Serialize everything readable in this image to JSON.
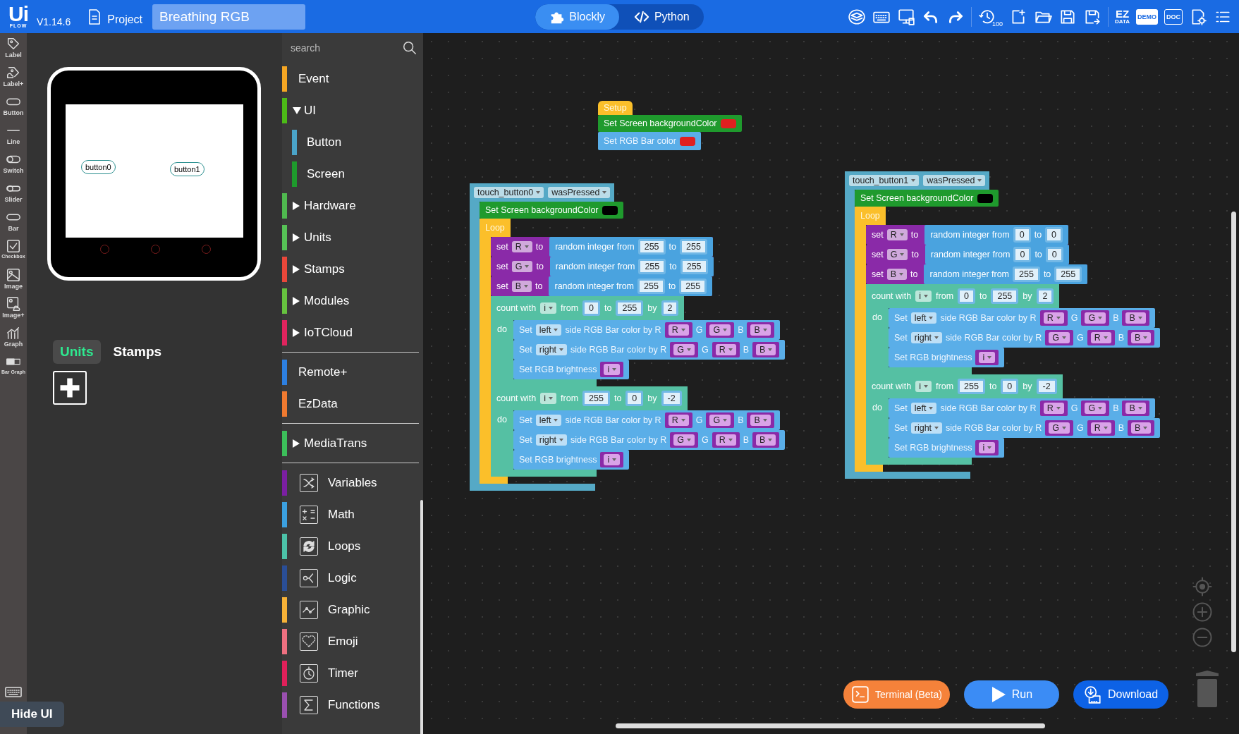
{
  "header": {
    "logo": {
      "mark": "Ui",
      "sub": "FLOW"
    },
    "version": "V1.14.6",
    "project_label": "Project",
    "project_name": "Breathing RGB",
    "modes": [
      {
        "label": "Blockly",
        "selected": true
      },
      {
        "label": "Python",
        "selected": false
      }
    ],
    "toolbar": [
      {
        "kind": "layers"
      },
      {
        "kind": "keyboard"
      },
      {
        "kind": "monitor"
      },
      {
        "kind": "undo"
      },
      {
        "kind": "redo"
      },
      {
        "kind": "history",
        "label": "100"
      },
      {
        "kind": "new"
      },
      {
        "kind": "open"
      },
      {
        "kind": "save"
      },
      {
        "kind": "save-as"
      },
      {
        "kind": "ezdata",
        "label": "EZ",
        "sublabel": "DATA"
      },
      {
        "kind": "demo",
        "label": "DEMO"
      },
      {
        "kind": "doc",
        "label": "DOC"
      },
      {
        "kind": "file-settings"
      },
      {
        "kind": "menu"
      }
    ]
  },
  "rail": {
    "items": [
      {
        "label": "Label"
      },
      {
        "label": "Label+"
      },
      {
        "label": "Button"
      },
      {
        "label": "Line"
      },
      {
        "label": "Switch"
      },
      {
        "label": "Slider"
      },
      {
        "label": "Bar"
      },
      {
        "label": "Checkbox"
      },
      {
        "label": "Image"
      },
      {
        "label": "Image+"
      },
      {
        "label": "Graph"
      },
      {
        "label": "Bar Graph"
      }
    ],
    "hide_button": "Hide UI"
  },
  "device": {
    "buttons": [
      {
        "label": "button0"
      },
      {
        "label": "button1"
      }
    ]
  },
  "panel_tabs": [
    {
      "label": "Units",
      "selected": true
    },
    {
      "label": "Stamps",
      "selected": false
    }
  ],
  "palette": {
    "search": {
      "placeholder": "search"
    },
    "groups": [
      {
        "items": [
          {
            "kind": "leaf",
            "label": "Event",
            "color": "#f5a623"
          },
          {
            "kind": "folder",
            "label": "UI",
            "color": "#4cbb17",
            "expanded": true,
            "children": [
              {
                "label": "Button",
                "color": "#4aa3c8"
              },
              {
                "label": "Screen",
                "color": "#1e9a2c"
              }
            ]
          },
          {
            "kind": "folder",
            "label": "Hardware",
            "color": "#4fb94f",
            "expanded": false
          },
          {
            "kind": "folder",
            "label": "Units",
            "color": "#56c256",
            "expanded": false
          },
          {
            "kind": "folder",
            "label": "Stamps",
            "color": "#e9473a",
            "expanded": false
          },
          {
            "kind": "folder",
            "label": "Modules",
            "color": "#66c23f",
            "expanded": false
          },
          {
            "kind": "folder",
            "label": "IoTCloud",
            "color": "#e0245e",
            "expanded": false
          }
        ]
      },
      {
        "items": [
          {
            "kind": "leaf",
            "label": "Remote+",
            "color": "#2d7fe0"
          },
          {
            "kind": "leaf",
            "label": "EzData",
            "color": "#f07a30"
          }
        ]
      },
      {
        "items": [
          {
            "kind": "folder",
            "label": "MediaTrans",
            "color": "#3cbf5a",
            "expanded": false
          }
        ]
      },
      {
        "items": [
          {
            "kind": "tool",
            "label": "Variables",
            "color": "#7b1fa2"
          },
          {
            "kind": "tool",
            "label": "Math",
            "color": "#3ba0e0"
          },
          {
            "kind": "tool",
            "label": "Loops",
            "color": "#4cc2a8"
          },
          {
            "kind": "tool",
            "label": "Logic",
            "color": "#2a4e96"
          },
          {
            "kind": "tool",
            "label": "Graphic",
            "color": "#f7b237"
          },
          {
            "kind": "tool",
            "label": "Emoji",
            "color": "#ee7080"
          },
          {
            "kind": "tool",
            "label": "Timer",
            "color": "#e0205a"
          },
          {
            "kind": "tool",
            "label": "Functions",
            "color": "#9a50b0"
          }
        ]
      }
    ]
  },
  "workspace": {
    "stacks": [
      {
        "kind": "setup",
        "label": "Setup",
        "body": [
          {
            "kind": "screen",
            "parts": [
              {
                "label": "Set Screen backgroundColor"
              },
              {
                "color": "#e02020"
              }
            ]
          },
          {
            "kind": "rgb",
            "parts": [
              {
                "label": "Set RGB Bar color"
              },
              {
                "color": "#e02020"
              }
            ]
          }
        ]
      },
      {
        "kind": "event",
        "parts": [
          {
            "dropdown": "touch_button0"
          },
          {
            "dropdown": "wasPressed"
          }
        ],
        "body": [
          {
            "kind": "screen",
            "parts": [
              {
                "label": "Set Screen backgroundColor"
              },
              {
                "color": "#000000"
              }
            ]
          },
          {
            "kind": "loop",
            "label": "Loop",
            "body": [
              {
                "kind": "variables",
                "parts": [
                  {
                    "label": "set"
                  },
                  {
                    "dropdown": "R"
                  },
                  {
                    "label": "to"
                  },
                  {
                    "value": {
                      "kind": "math",
                      "parts": [
                        {
                          "label": "random integer from"
                        },
                        {
                          "number": "255"
                        },
                        {
                          "label": "to"
                        },
                        {
                          "number": "255"
                        }
                      ]
                    }
                  }
                ]
              },
              {
                "kind": "variables",
                "parts": [
                  {
                    "label": "set"
                  },
                  {
                    "dropdown": "G"
                  },
                  {
                    "label": "to"
                  },
                  {
                    "value": {
                      "kind": "math",
                      "parts": [
                        {
                          "label": "random integer from"
                        },
                        {
                          "number": "255"
                        },
                        {
                          "label": "to"
                        },
                        {
                          "number": "255"
                        }
                      ]
                    }
                  }
                ]
              },
              {
                "kind": "variables",
                "parts": [
                  {
                    "label": "set"
                  },
                  {
                    "dropdown": "B"
                  },
                  {
                    "label": "to"
                  },
                  {
                    "value": {
                      "kind": "math",
                      "parts": [
                        {
                          "label": "random integer from"
                        },
                        {
                          "number": "255"
                        },
                        {
                          "label": "to"
                        },
                        {
                          "number": "255"
                        }
                      ]
                    }
                  }
                ]
              },
              {
                "kind": "count",
                "parts": [
                  {
                    "label": "count with"
                  },
                  {
                    "dropdown": "i"
                  },
                  {
                    "label": "from"
                  },
                  {
                    "number": "0"
                  },
                  {
                    "label": "to"
                  },
                  {
                    "number": "255"
                  },
                  {
                    "label": "by"
                  },
                  {
                    "number": "2"
                  }
                ],
                "do": "do",
                "body": [
                  {
                    "kind": "rgb",
                    "parts": [
                      {
                        "label": "Set"
                      },
                      {
                        "dropdown": "left"
                      },
                      {
                        "label": "side RGB Bar color by R"
                      },
                      {
                        "var": "R"
                      },
                      {
                        "label": "G"
                      },
                      {
                        "var": "G"
                      },
                      {
                        "label": "B"
                      },
                      {
                        "var": "B"
                      }
                    ]
                  },
                  {
                    "kind": "rgb",
                    "parts": [
                      {
                        "label": "Set"
                      },
                      {
                        "dropdown": "right"
                      },
                      {
                        "label": "side RGB Bar color by R"
                      },
                      {
                        "var": "G"
                      },
                      {
                        "label": "G"
                      },
                      {
                        "var": "R"
                      },
                      {
                        "label": "B"
                      },
                      {
                        "var": "B"
                      }
                    ]
                  },
                  {
                    "kind": "rgb",
                    "parts": [
                      {
                        "label": "Set RGB brightness"
                      },
                      {
                        "var": "i"
                      }
                    ]
                  }
                ]
              },
              {
                "kind": "count",
                "parts": [
                  {
                    "label": "count with"
                  },
                  {
                    "dropdown": "i"
                  },
                  {
                    "label": "from"
                  },
                  {
                    "number": "255"
                  },
                  {
                    "label": "to"
                  },
                  {
                    "number": "0"
                  },
                  {
                    "label": "by"
                  },
                  {
                    "number": "-2"
                  }
                ],
                "do": "do",
                "body": [
                  {
                    "kind": "rgb",
                    "parts": [
                      {
                        "label": "Set"
                      },
                      {
                        "dropdown": "left"
                      },
                      {
                        "label": "side RGB Bar color by R"
                      },
                      {
                        "var": "R"
                      },
                      {
                        "label": "G"
                      },
                      {
                        "var": "G"
                      },
                      {
                        "label": "B"
                      },
                      {
                        "var": "B"
                      }
                    ]
                  },
                  {
                    "kind": "rgb",
                    "parts": [
                      {
                        "label": "Set"
                      },
                      {
                        "dropdown": "right"
                      },
                      {
                        "label": "side RGB Bar color by R"
                      },
                      {
                        "var": "G"
                      },
                      {
                        "label": "G"
                      },
                      {
                        "var": "R"
                      },
                      {
                        "label": "B"
                      },
                      {
                        "var": "B"
                      }
                    ]
                  },
                  {
                    "kind": "rgb",
                    "parts": [
                      {
                        "label": "Set RGB brightness"
                      },
                      {
                        "var": "i"
                      }
                    ]
                  }
                ]
              }
            ]
          }
        ]
      },
      {
        "kind": "event",
        "parts": [
          {
            "dropdown": "touch_button1"
          },
          {
            "dropdown": "wasPressed"
          }
        ],
        "body": [
          {
            "kind": "screen",
            "parts": [
              {
                "label": "Set Screen backgroundColor"
              },
              {
                "color": "#000000"
              }
            ]
          },
          {
            "kind": "loop",
            "label": "Loop",
            "body": [
              {
                "kind": "variables",
                "parts": [
                  {
                    "label": "set"
                  },
                  {
                    "dropdown": "R"
                  },
                  {
                    "label": "to"
                  },
                  {
                    "value": {
                      "kind": "math",
                      "parts": [
                        {
                          "label": "random integer from"
                        },
                        {
                          "number": "0"
                        },
                        {
                          "label": "to"
                        },
                        {
                          "number": "0"
                        }
                      ]
                    }
                  }
                ]
              },
              {
                "kind": "variables",
                "parts": [
                  {
                    "label": "set"
                  },
                  {
                    "dropdown": "G"
                  },
                  {
                    "label": "to"
                  },
                  {
                    "value": {
                      "kind": "math",
                      "parts": [
                        {
                          "label": "random integer from"
                        },
                        {
                          "number": "0"
                        },
                        {
                          "label": "to"
                        },
                        {
                          "number": "0"
                        }
                      ]
                    }
                  }
                ]
              },
              {
                "kind": "variables",
                "parts": [
                  {
                    "label": "set"
                  },
                  {
                    "dropdown": "B"
                  },
                  {
                    "label": "to"
                  },
                  {
                    "value": {
                      "kind": "math",
                      "parts": [
                        {
                          "label": "random integer from"
                        },
                        {
                          "number": "255"
                        },
                        {
                          "label": "to"
                        },
                        {
                          "number": "255"
                        }
                      ]
                    }
                  }
                ]
              },
              {
                "kind": "count",
                "parts": [
                  {
                    "label": "count with"
                  },
                  {
                    "dropdown": "i"
                  },
                  {
                    "label": "from"
                  },
                  {
                    "number": "0"
                  },
                  {
                    "label": "to"
                  },
                  {
                    "number": "255"
                  },
                  {
                    "label": "by"
                  },
                  {
                    "number": "2"
                  }
                ],
                "do": "do",
                "body": [
                  {
                    "kind": "rgb",
                    "parts": [
                      {
                        "label": "Set"
                      },
                      {
                        "dropdown": "left"
                      },
                      {
                        "label": "side RGB Bar color by R"
                      },
                      {
                        "var": "R"
                      },
                      {
                        "label": "G"
                      },
                      {
                        "var": "G"
                      },
                      {
                        "label": "B"
                      },
                      {
                        "var": "B"
                      }
                    ]
                  },
                  {
                    "kind": "rgb",
                    "parts": [
                      {
                        "label": "Set"
                      },
                      {
                        "dropdown": "right"
                      },
                      {
                        "label": "side RGB Bar color by R"
                      },
                      {
                        "var": "G"
                      },
                      {
                        "label": "G"
                      },
                      {
                        "var": "R"
                      },
                      {
                        "label": "B"
                      },
                      {
                        "var": "B"
                      }
                    ]
                  },
                  {
                    "kind": "rgb",
                    "parts": [
                      {
                        "label": "Set RGB brightness"
                      },
                      {
                        "var": "i"
                      }
                    ]
                  }
                ]
              },
              {
                "kind": "count",
                "parts": [
                  {
                    "label": "count with"
                  },
                  {
                    "dropdown": "i"
                  },
                  {
                    "label": "from"
                  },
                  {
                    "number": "255"
                  },
                  {
                    "label": "to"
                  },
                  {
                    "number": "0"
                  },
                  {
                    "label": "by"
                  },
                  {
                    "number": "-2"
                  }
                ],
                "do": "do",
                "body": [
                  {
                    "kind": "rgb",
                    "parts": [
                      {
                        "label": "Set"
                      },
                      {
                        "dropdown": "left"
                      },
                      {
                        "label": "side RGB Bar color by R"
                      },
                      {
                        "var": "R"
                      },
                      {
                        "label": "G"
                      },
                      {
                        "var": "G"
                      },
                      {
                        "label": "B"
                      },
                      {
                        "var": "B"
                      }
                    ]
                  },
                  {
                    "kind": "rgb",
                    "parts": [
                      {
                        "label": "Set"
                      },
                      {
                        "dropdown": "right"
                      },
                      {
                        "label": "side RGB Bar color by R"
                      },
                      {
                        "var": "G"
                      },
                      {
                        "label": "G"
                      },
                      {
                        "var": "R"
                      },
                      {
                        "label": "B"
                      },
                      {
                        "var": "B"
                      }
                    ]
                  },
                  {
                    "kind": "rgb",
                    "parts": [
                      {
                        "label": "Set RGB brightness"
                      },
                      {
                        "var": "i"
                      }
                    ]
                  }
                ]
              }
            ]
          }
        ]
      }
    ]
  },
  "actions": [
    {
      "kind": "terminal",
      "label": "Terminal (Beta)"
    },
    {
      "kind": "run",
      "label": "Run"
    },
    {
      "kind": "download",
      "label": "Download"
    }
  ]
}
